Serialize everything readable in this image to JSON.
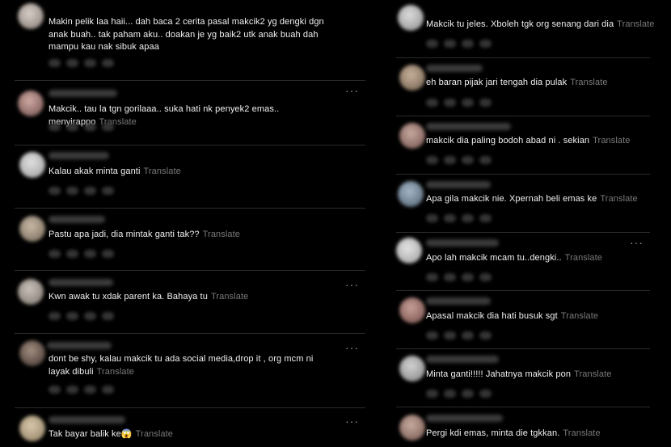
{
  "translate_label": "Translate",
  "left_comments": [
    {
      "text": "Makin pelik laa haii... dah baca 2 cerita pasal makcik2 yg dengki dgn anak buah.. tak paham aku.. doakan je yg baik2 utk anak buah dah mampu kau nak sibuk apaa",
      "has_translate": false
    },
    {
      "text": "Makcik.. tau la tgn gorilaaa.. suka hati nk penyek2 emas.. menyirappo",
      "has_translate": true
    },
    {
      "text": "Kalau akak minta ganti",
      "has_translate": true
    },
    {
      "text": "Pastu apa jadi, dia mintak ganti tak??",
      "has_translate": true
    },
    {
      "text": "Kwn awak tu xdak parent ka. Bahaya tu",
      "has_translate": true
    },
    {
      "text": "dont be shy, kalau makcik tu ada social media,drop it , org mcm ni layak dibuli",
      "has_translate": true
    },
    {
      "text": "Tak bayar balik ke😱",
      "has_translate": true
    }
  ],
  "right_comments": [
    {
      "text": "Makcik tu jeles. Xboleh tgk org senang dari dia",
      "has_translate": true
    },
    {
      "text": "eh baran pijak jari tengah dia pulak",
      "has_translate": true
    },
    {
      "text": "makcik dia paling bodoh abad ni . sekian",
      "has_translate": true
    },
    {
      "text": "Apa gila makcik nie. Xpernah beli emas ke",
      "has_translate": true
    },
    {
      "text": "Apo lah makcik mcam tu..dengki..",
      "has_translate": true
    },
    {
      "text": "Apasal makcik dia hati busuk sgt",
      "has_translate": true
    },
    {
      "text": "Minta ganti!!!!! Jahatnya makcik pon",
      "has_translate": true
    },
    {
      "text": "Pergi kdi emas, minta die tgkkan.",
      "has_translate": true
    }
  ],
  "more_icon": "···",
  "colors": {
    "background": "#000000",
    "text": "#f1f1f1",
    "translate": "#7a7a7a",
    "divider": "#2b2b2b"
  }
}
